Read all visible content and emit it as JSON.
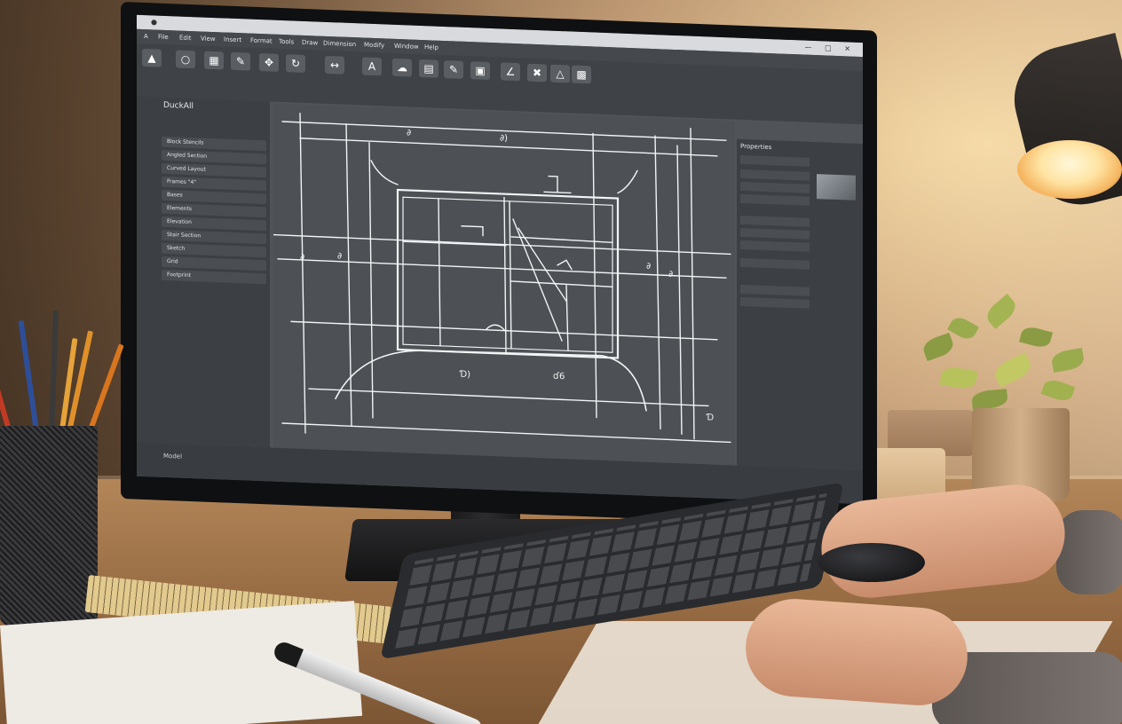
{
  "scene": {
    "description_tag": "photo-cad-workstation"
  },
  "app": {
    "menu_items": [
      "A",
      "File",
      "Edit",
      "View",
      "Insert",
      "Format",
      "Tools",
      "Draw",
      "Dimension",
      "Modify",
      "Window",
      "Help"
    ],
    "left_panel_title": "DuckAll",
    "layers": [
      "Block Stencils",
      "Angled Section",
      "Curved Layout",
      "Frames \"4\"",
      "Bases",
      "Elements",
      "Elevation",
      "Stair Section",
      "Sketch",
      "Grid",
      "Footprint"
    ],
    "right_panel_title": "Properties",
    "status_text": "Model"
  },
  "colors": {
    "screen_bg": "#505458",
    "canvas_bg": "#4d5155",
    "sketch_lines": "#f2f4f5",
    "lamp_glow": "#ffe4a3"
  }
}
